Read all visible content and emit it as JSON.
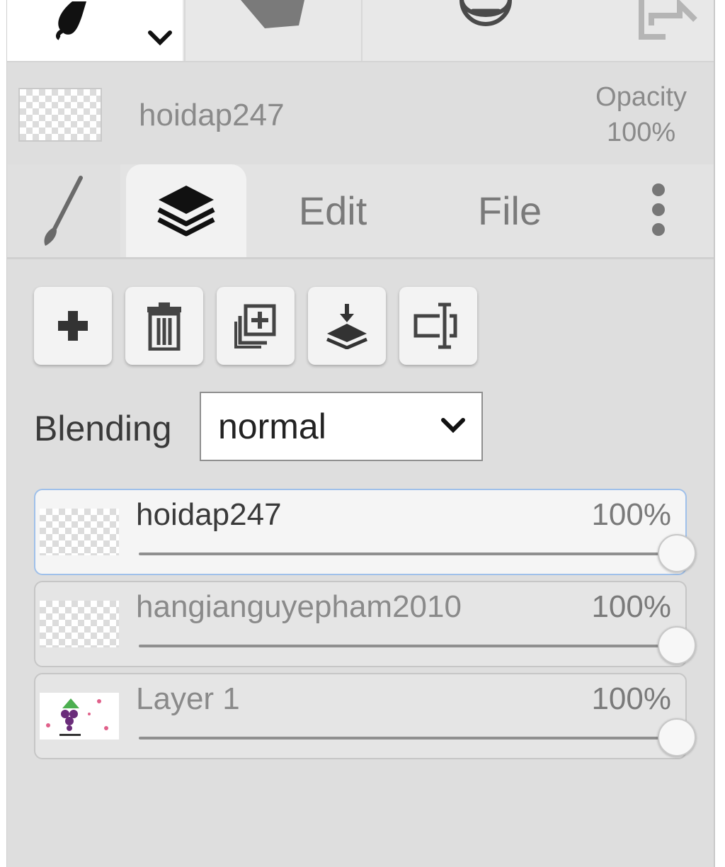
{
  "toolbar": {
    "tools": [
      {
        "name": "brush-tool-icon",
        "active": true
      },
      {
        "name": "shape-tool-icon",
        "active": false
      },
      {
        "name": "zoom-out-icon",
        "active": false
      },
      {
        "name": "export-icon",
        "active": false
      }
    ]
  },
  "current_layer": {
    "name": "hoidap247",
    "opacity_label": "Opacity",
    "opacity_value": "100%"
  },
  "tabs": {
    "edit_label": "Edit",
    "file_label": "File",
    "active": "layers"
  },
  "actions": [
    {
      "name": "add-layer-icon"
    },
    {
      "name": "delete-layer-icon"
    },
    {
      "name": "duplicate-layer-icon"
    },
    {
      "name": "merge-down-icon"
    },
    {
      "name": "rename-layer-icon"
    }
  ],
  "blending": {
    "label": "Blending",
    "value": "normal"
  },
  "layers": [
    {
      "name": "hoidap247",
      "opacity": "100%",
      "opacity_fraction": 1.0,
      "selected": true
    },
    {
      "name": "hangianguyepham2010",
      "opacity": "100%",
      "opacity_fraction": 1.0,
      "selected": false
    },
    {
      "name": "Layer 1",
      "opacity": "100%",
      "opacity_fraction": 1.0,
      "selected": false
    }
  ],
  "colors": {
    "selection_border": "#9fc0ea",
    "panel_background": "#dedede"
  }
}
